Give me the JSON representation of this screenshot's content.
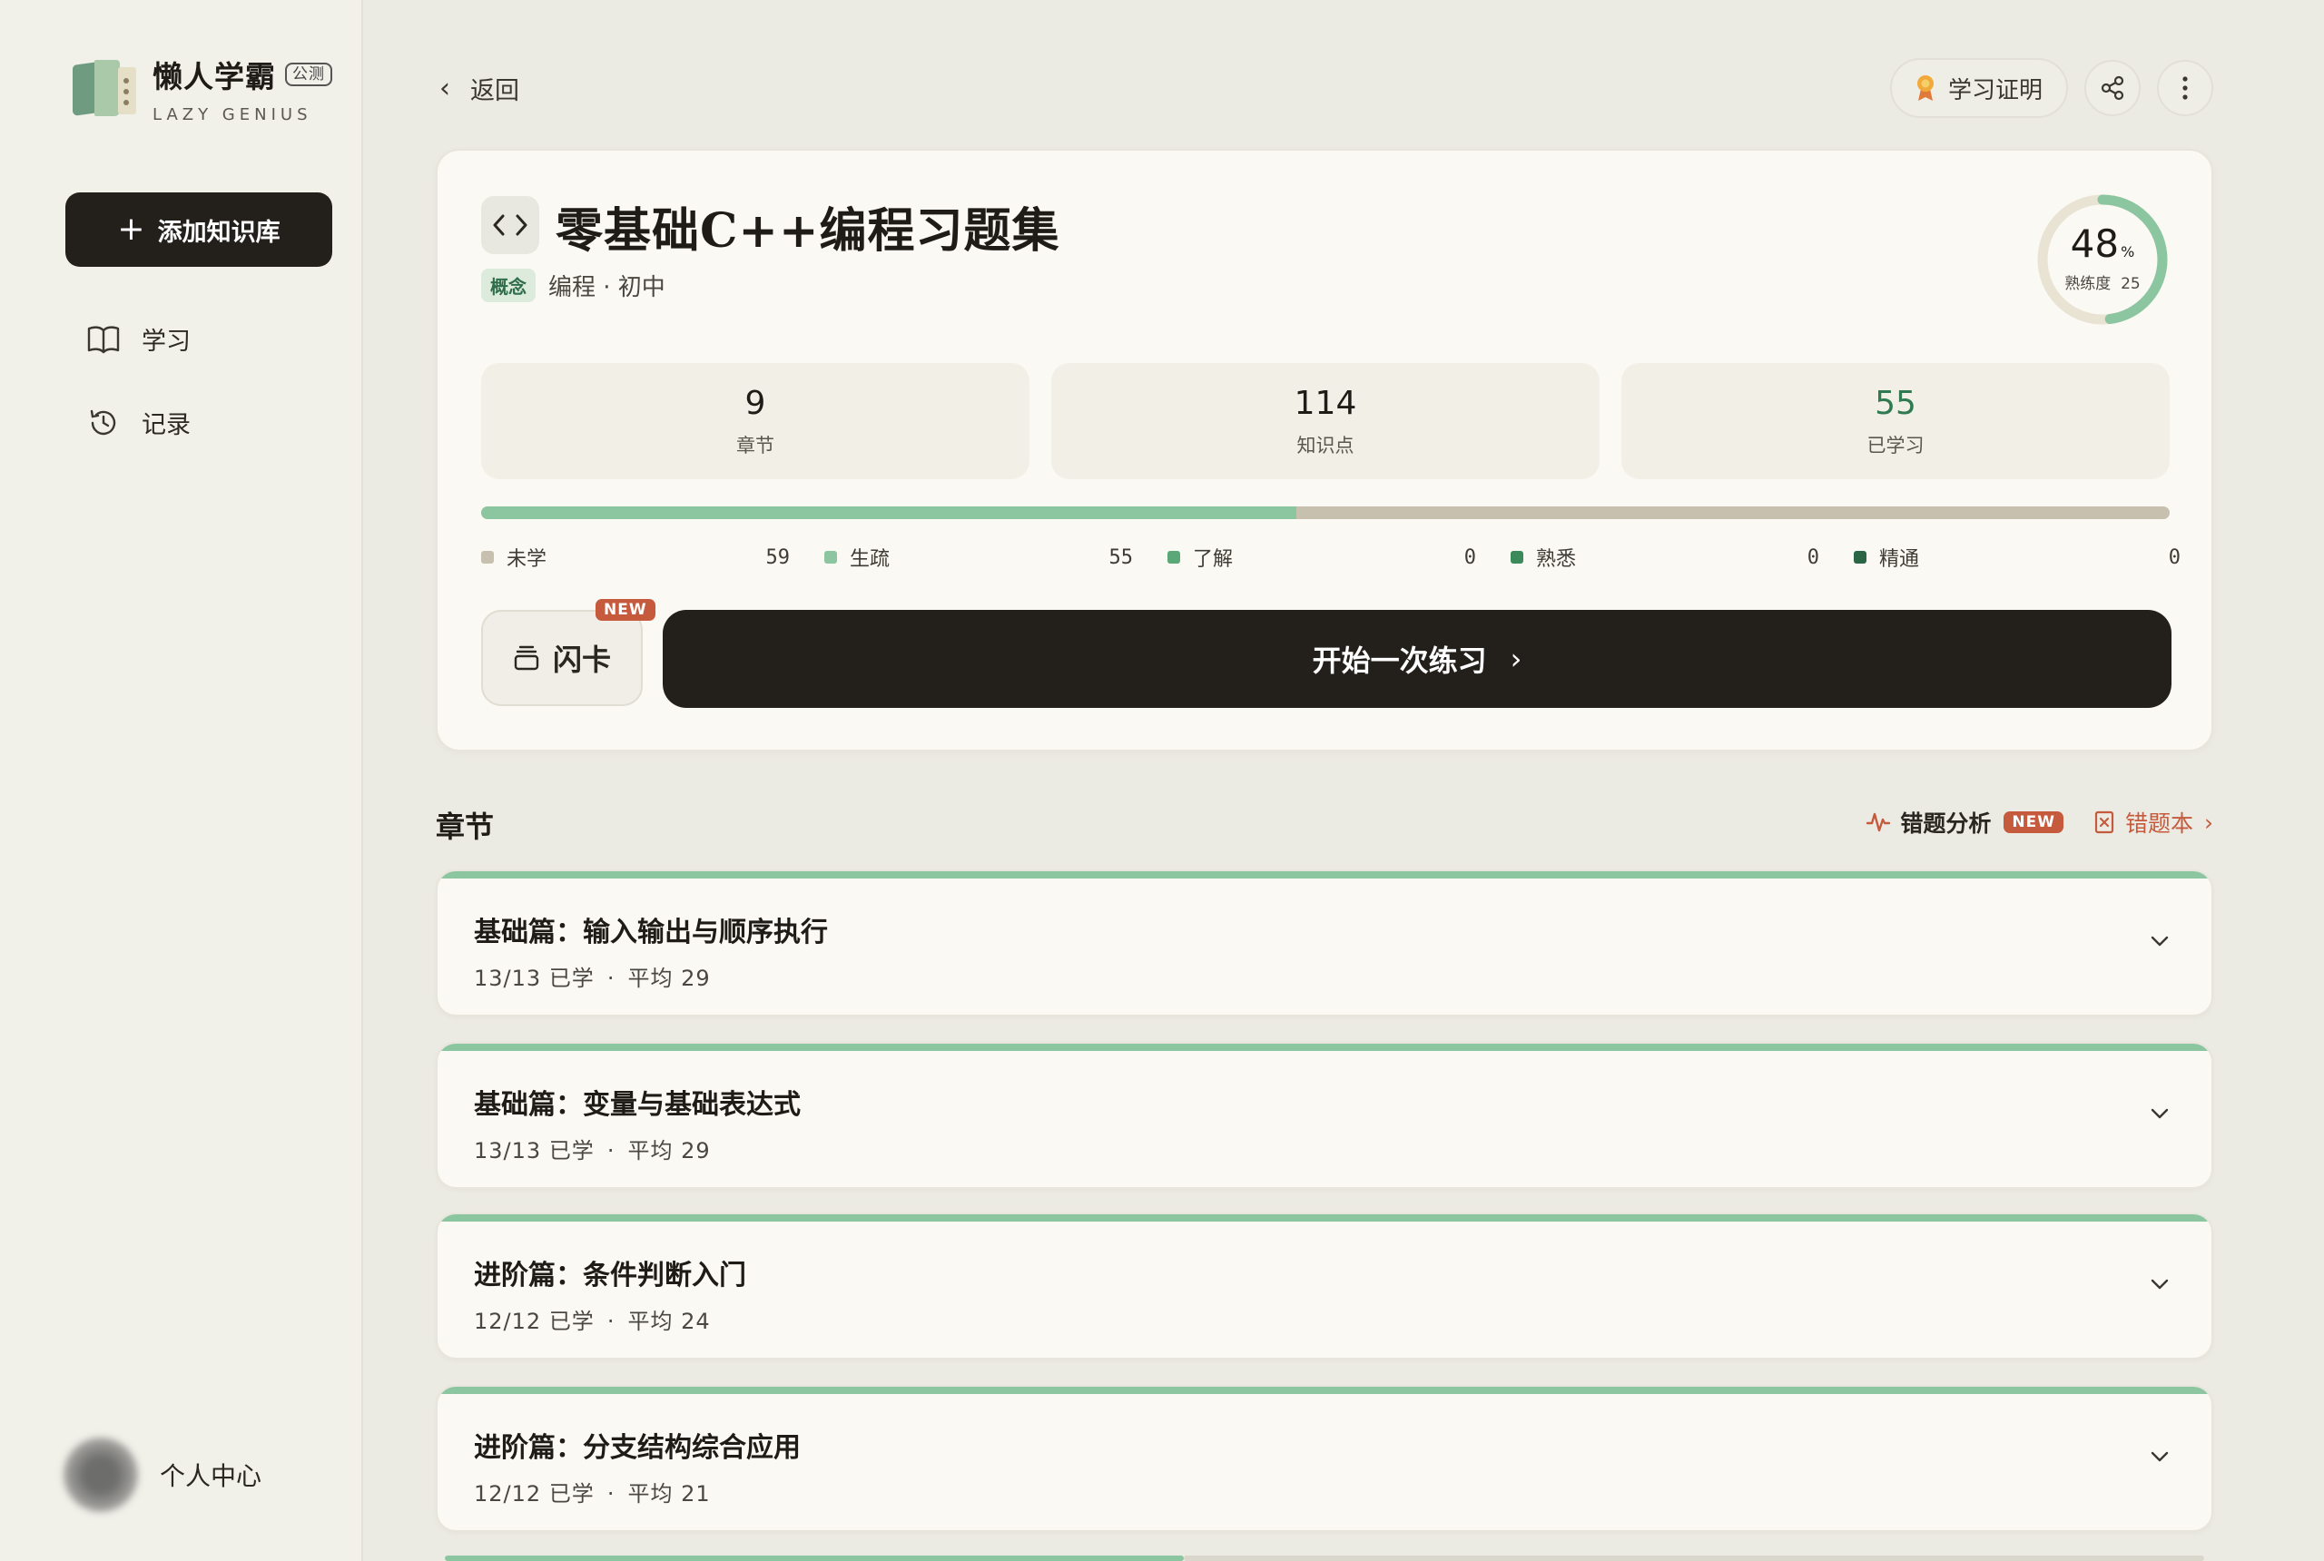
{
  "brand": {
    "name": "懒人学霸",
    "badge": "公测",
    "sub": "LAZY GENIUS"
  },
  "sidebar": {
    "add_button": "添加知识库",
    "items": [
      {
        "label": "学习",
        "icon": "book-icon"
      },
      {
        "label": "记录",
        "icon": "history-icon"
      }
    ],
    "profile": "个人中心"
  },
  "header": {
    "back": "返回",
    "certificate": "学习证明"
  },
  "course": {
    "title": "零基础C++编程习题集",
    "tag": "概念",
    "subtitle": "编程 · 初中",
    "mastery": {
      "value": "48",
      "unit": "%",
      "label": "熟练度",
      "count": "25",
      "fraction": 0.48
    },
    "stats": [
      {
        "value": "9",
        "label": "章节"
      },
      {
        "value": "114",
        "label": "知识点"
      },
      {
        "value": "55",
        "label": "已学习"
      }
    ],
    "progress_fraction": 0.483,
    "legend": [
      {
        "label": "未学",
        "count": "59",
        "color": "#c7c0ae"
      },
      {
        "label": "生疏",
        "count": "55",
        "color": "#8cc6a0"
      },
      {
        "label": "了解",
        "count": "0",
        "color": "#5aa877"
      },
      {
        "label": "熟悉",
        "count": "0",
        "color": "#3b8a5a"
      },
      {
        "label": "精通",
        "count": "0",
        "color": "#2a6646"
      }
    ],
    "flashcard": "闪卡",
    "new_badge": "NEW",
    "start": "开始一次练习"
  },
  "chapters_section": {
    "title": "章节",
    "error_analysis": "错题分析",
    "error_analysis_badge": "NEW",
    "error_book": "错题本",
    "items": [
      {
        "title": "基础篇：输入输出与顺序执行",
        "progress": "13/13",
        "learned": "已学",
        "avg_label": "平均",
        "avg": "29",
        "fraction": 1.0
      },
      {
        "title": "基础篇：变量与基础表达式",
        "progress": "13/13",
        "learned": "已学",
        "avg_label": "平均",
        "avg": "29",
        "fraction": 1.0
      },
      {
        "title": "进阶篇：条件判断入门",
        "progress": "12/12",
        "learned": "已学",
        "avg_label": "平均",
        "avg": "24",
        "fraction": 1.0
      },
      {
        "title": "进阶篇：分支结构综合应用",
        "progress": "12/12",
        "learned": "已学",
        "avg_label": "平均",
        "avg": "21",
        "fraction": 1.0
      }
    ]
  }
}
